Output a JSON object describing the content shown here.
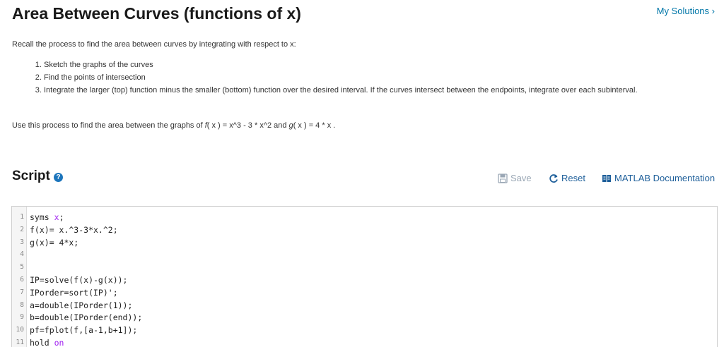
{
  "header": {
    "title": "Area Between Curves (functions of x)",
    "my_solutions": "My Solutions"
  },
  "description": {
    "intro": "Recall the process to find the area between curves by integrating with respect to x:",
    "steps": [
      "Sketch the graphs of the curves",
      "Find the points of intersection",
      "Integrate the larger (top) function minus the smaller (bottom) function over the desired interval. If the curves intersect between the endpoints, integrate over each subinterval."
    ],
    "use_prefix": "Use this process to find the area between the graphs of ",
    "f_name": "f",
    "f_expr": "( x ) = x^3 - 3 * x^2",
    "and_text": " and ",
    "g_name": "g",
    "g_expr": "( x ) = 4 * x",
    "use_suffix": " ."
  },
  "script": {
    "title": "Script",
    "help_icon": "?",
    "save_label": "Save",
    "reset_label": "Reset",
    "doc_label": "MATLAB Documentation"
  },
  "editor": {
    "lines": [
      {
        "n": "1",
        "code": "syms ",
        "kw": "x",
        "after": ";"
      },
      {
        "n": "2",
        "code": "f(x)= x.^3-3*x.^2;"
      },
      {
        "n": "3",
        "code": "g(x)= 4*x;"
      },
      {
        "n": "4",
        "code": ""
      },
      {
        "n": "5",
        "code": ""
      },
      {
        "n": "6",
        "code": "IP=solve(f(x)-g(x));"
      },
      {
        "n": "7",
        "code": "IPorder=sort(IP)';"
      },
      {
        "n": "8",
        "code": "a=double(IPorder(1));"
      },
      {
        "n": "9",
        "code": "b=double(IPorder(end));"
      },
      {
        "n": "10",
        "code": "pf=fplot(f,[a-1,b+1]);"
      },
      {
        "n": "11",
        "code": "hold ",
        "kw": "on"
      }
    ]
  },
  "colors": {
    "link": "#0076a8",
    "accent": "#1e5f9a",
    "disabled": "#9aa7b5",
    "keyword": "#a020f0"
  }
}
